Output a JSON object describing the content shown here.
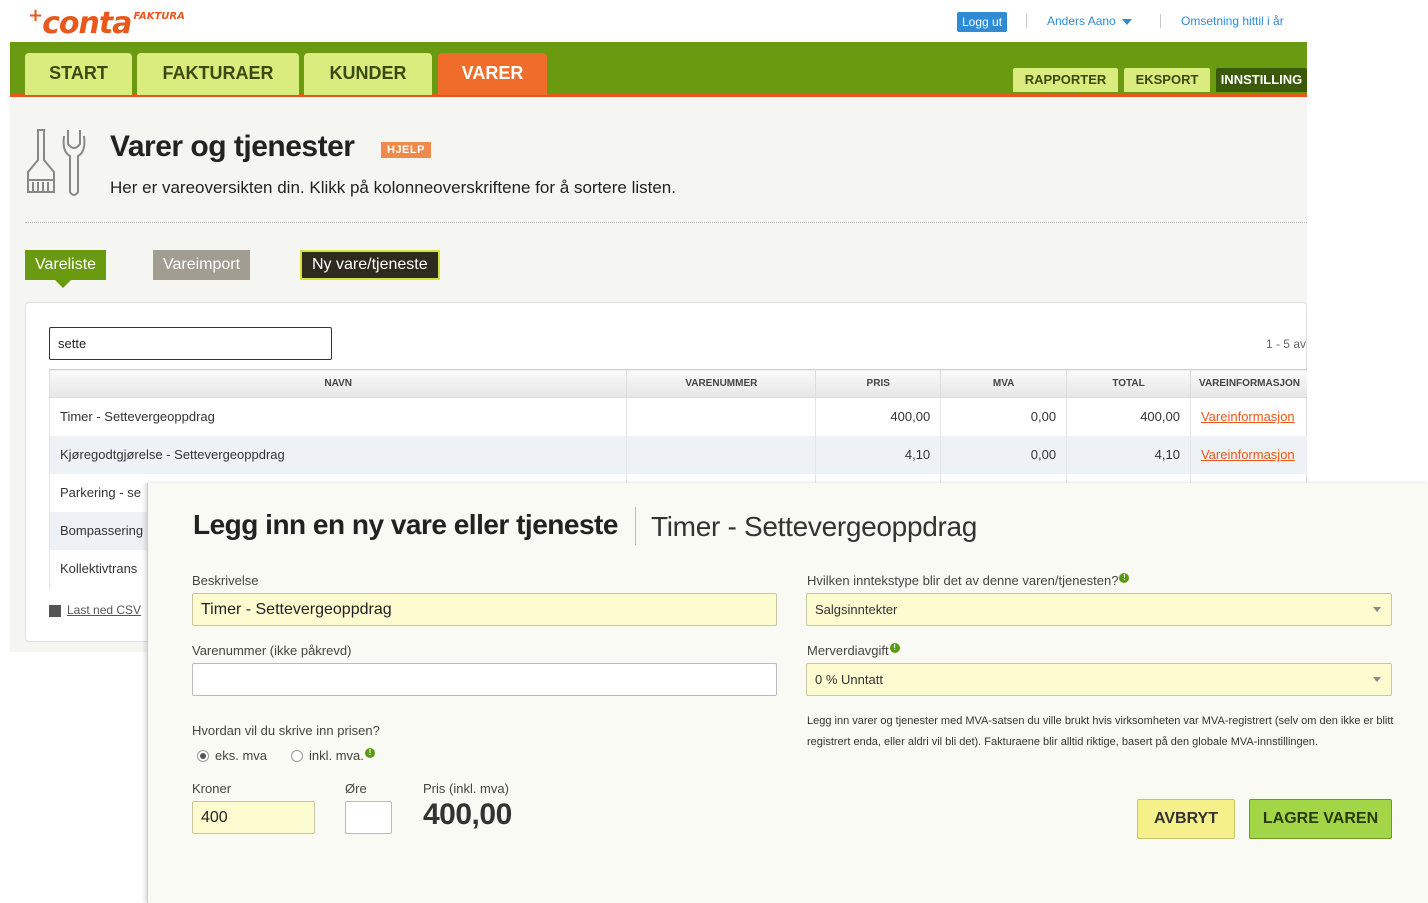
{
  "header": {
    "logo_text": "conta",
    "logo_sub": "FAKTURA",
    "logout": "Logg ut",
    "user": "Anders Aano",
    "revenue_link": "Omsetning hittil i år"
  },
  "nav": {
    "tabs": [
      {
        "label": "START"
      },
      {
        "label": "FAKTURAER"
      },
      {
        "label": "KUNDER"
      },
      {
        "label": "VARER"
      }
    ],
    "sub_tabs": [
      {
        "label": "RAPPORTER"
      },
      {
        "label": "EKSPORT"
      },
      {
        "label": "INNSTILLING"
      }
    ]
  },
  "page": {
    "title": "Varer og tjenester",
    "help": "HJELP",
    "subtitle": "Her er vareoversikten din. Klikk på kolonneoverskriftene for å sortere listen."
  },
  "subnav": {
    "vareliste": "Vareliste",
    "vareimport": "Vareimport",
    "nyvare": "Ny vare/tjeneste"
  },
  "list": {
    "search_value": "sette",
    "pager": "1 - 5 av",
    "columns": [
      "NAVN",
      "VARENUMMER",
      "PRIS",
      "MVA",
      "TOTAL",
      "VAREINFORMASJON"
    ],
    "rows": [
      {
        "name": "Timer - Settevergeoppdrag",
        "number": "",
        "price": "400,00",
        "vat": "0,00",
        "total": "400,00",
        "info": "Vareinformasjon"
      },
      {
        "name": "Kjøregodtgjørelse - Settevergeoppdrag",
        "number": "",
        "price": "4,10",
        "vat": "0,00",
        "total": "4,10",
        "info": "Vareinformasjon"
      },
      {
        "name": "Parkering - se",
        "number": "",
        "price": "",
        "vat": "",
        "total": "",
        "info": ""
      },
      {
        "name": "Bompassering",
        "number": "",
        "price": "",
        "vat": "",
        "total": "",
        "info": ""
      },
      {
        "name": "Kollektivtrans",
        "number": "",
        "price": "",
        "vat": "",
        "total": "",
        "info": ""
      }
    ],
    "csv": "Last ned CSV"
  },
  "modal": {
    "title": "Legg inn en ny vare eller tjeneste",
    "subtitle": "Timer - Settevergeoppdrag",
    "description_label": "Beskrivelse",
    "description_value": "Timer - Settevergeoppdrag",
    "number_label": "Varenummer (ikke påkrevd)",
    "number_value": "",
    "price_mode_label": "Hvordan vil du skrive inn prisen?",
    "radio_ex": "eks. mva",
    "radio_inc": "inkl. mva.",
    "kroner_label": "Kroner",
    "kroner_value": "400",
    "ore_label": "Øre",
    "ore_value": "",
    "price_inc_label": "Pris (inkl. mva)",
    "price_inc_value": "400,00",
    "income_label": "Hvilken inntekstype blir det av denne varen/tjenesten?",
    "income_value": "Salgsinntekter",
    "vat_label": "Merverdiavgift",
    "vat_value": "0 % Unntatt",
    "vat_note": "Legg inn varer og tjenester med MVA-satsen du ville brukt hvis virksomheten var MVA-registrert (selv om den ikke er blitt registrert enda, eller aldri vil bli det). Fakturaene blir alltid riktige, basert på den globale MVA-innstillingen.",
    "cancel": "AVBRYT",
    "save": "LAGRE VAREN"
  }
}
